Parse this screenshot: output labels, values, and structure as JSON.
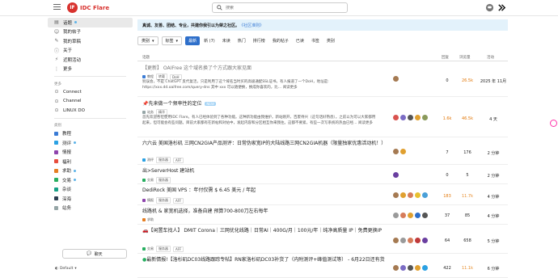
{
  "header": {
    "site_name": "IDC Flare",
    "logo_letter": "IF",
    "search_placeholder": "搜索",
    "brand_color": "#d8322e"
  },
  "sidebar": {
    "items": [
      {
        "label": "话题",
        "icon": "topics-icon",
        "active": true,
        "dot": true
      },
      {
        "label": "我的帖子",
        "icon": "user-icon"
      },
      {
        "label": "我的草稿",
        "icon": "draft-icon"
      },
      {
        "label": "关于",
        "icon": "info-icon"
      },
      {
        "label": "近期活动",
        "icon": "bolt-icon"
      },
      {
        "label": "更多",
        "icon": "more-icon"
      }
    ],
    "section_external": "更多",
    "external": [
      {
        "label": "Connect",
        "icon": "connect-icon"
      },
      {
        "label": "Channel",
        "icon": "channel-icon"
      },
      {
        "label": "LINUX DO",
        "icon": "linux-icon"
      }
    ],
    "section_categories": "类别",
    "categories": [
      {
        "label": "教程",
        "color": "#3a7bd5"
      },
      {
        "label": "测评",
        "color": "#2ba1e3",
        "dot": true
      },
      {
        "label": "情报",
        "color": "#8e44ad"
      },
      {
        "label": "福利",
        "color": "#e74c3c"
      },
      {
        "label": "求助",
        "color": "#e67e22",
        "dot": true
      },
      {
        "label": "交易",
        "color": "#27ae60",
        "dot": true
      },
      {
        "label": "杂谈",
        "color": "#16a085"
      },
      {
        "label": "深海",
        "color": "#2c3e50"
      },
      {
        "label": "站务",
        "color": "#95a5a6"
      }
    ],
    "chat_button": "聊天",
    "theme": "Default"
  },
  "main": {
    "banner_text": "真诚、友善、团结、专业，共建你我引以为荣之社区。",
    "banner_link": "《社区准则》",
    "dropdowns": [
      "类别",
      "标签"
    ],
    "tabs": [
      {
        "label": "最新",
        "active": true
      },
      {
        "label": "新 (7)"
      },
      {
        "label": "未读"
      },
      {
        "label": "热门"
      },
      {
        "label": "排行榜"
      },
      {
        "label": "我的帖子"
      },
      {
        "label": "已读"
      },
      {
        "label": "书签"
      },
      {
        "label": "类别"
      }
    ],
    "columns": {
      "topic": "话题",
      "replies": "回复",
      "views": "浏览量",
      "activity": "活动"
    },
    "topics": [
      {
        "title": "【更新】 OAIFree 这个域名换了个方式跟大家见面",
        "read": true,
        "category": "教程",
        "category_color": "#3a7bd5",
        "tags": [
          "转载",
          "DoH"
        ],
        "excerpt": "别误会，不是 ChatGPT 反代复活，只是利用了这个域名当时买的高级通配SSL证书。有人报道了一个DoH，地址是: https://xxx.dd.oaifree.com/query-dns 其中 xxx 可以随便换，换成你喜欢的，比… 阅读更多",
        "replies": "0",
        "views": "26.5k",
        "views_hot": true,
        "activity": "2025 年 11月"
      },
      {
        "title": "先来做一个频率性的定位",
        "badge": "NEW",
        "category": "站务",
        "category_color": "#95a5a6",
        "tags": [
          "精华"
        ],
        "excerpt": "首先欢迎各位使用IDC Flare。有人已经体验到了各种功能。这种新功能由我维护。新站刚开，百废待兴（这句话好熟悉）。之前以为可以大家都用起来，但可能会有些问题。目前大家都有在新帖和对帖中，发起内容和分区相互你来我往。这都不要紧，有些一次写系统的热血已经… 阅读更多",
        "replies": "1.6k",
        "views": "46.5k",
        "views_hot": true,
        "activity": "4 天"
      },
      {
        "title": "六六云 美国洛杉矶 三网CN2GIA产品测评：日常伪家宽IP的大陆线路三网CN2GIA机器（限量独家优惠活动机！）",
        "category": "测评",
        "category_color": "#2ba1e3",
        "tags": [
          "服务器",
          "AFF"
        ],
        "replies": "7",
        "views": "176",
        "activity": "2 分钟"
      },
      {
        "title": "出>ServerHost 建站机",
        "category": "交易",
        "category_color": "#27ae60",
        "tags": [
          "服务器"
        ],
        "replies": "0",
        "views": "5",
        "activity": "2 分钟"
      },
      {
        "title": "DediRock 美国 VPS ：年付仅需 $ 6.45 美元 / 年起",
        "category": "情报",
        "category_color": "#8e44ad",
        "tags": [
          "服务器",
          "AFF"
        ],
        "replies": "183",
        "views": "11.7k",
        "views_hot": true,
        "activity": "4 分钟"
      },
      {
        "title": "线路机 & 家宽机选择，准备自建 预算700-800刀左右每年",
        "category": "求助",
        "category_color": "#e67e22",
        "tags": [],
        "replies": "37",
        "views": "85",
        "activity": "4 分钟"
      },
      {
        "title": "【闲置车找人】 DMIT Corona｜三网优化线路｜日常AI｜400G/月｜100元/年｜纯净高质量 IP｜免费更换IP",
        "category": "交易",
        "category_color": "#27ae60",
        "tags": [
          "服务器",
          "AFF"
        ],
        "replies": "64",
        "views": "658",
        "activity": "5 分钟"
      },
      {
        "title": "最新情报!【洛杉矶DC03线路跟踪专帖】RN家洛杉矶DC03补货了（内附测评+峰值测试等） - 6月22日还有货",
        "category": "测评",
        "category_color": "#2ba1e3",
        "tags": [],
        "replies": "422",
        "views": "11.1k",
        "views_hot": true,
        "activity": "6 分钟"
      }
    ]
  }
}
